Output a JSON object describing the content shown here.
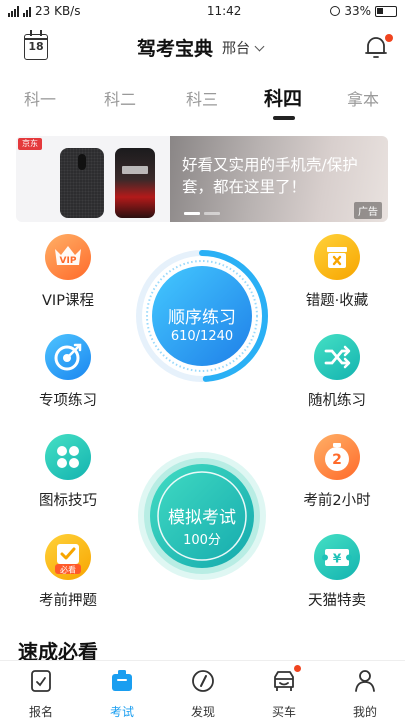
{
  "status_bar": {
    "network": "23 KB/s",
    "time": "11:42",
    "battery": "33%"
  },
  "header": {
    "calendar_day": "18",
    "title": "驾考宝典",
    "city": "邢台"
  },
  "tabs": [
    {
      "label": "科一"
    },
    {
      "label": "科二"
    },
    {
      "label": "科三"
    },
    {
      "label": "科四",
      "active": true
    },
    {
      "label": "拿本"
    }
  ],
  "banner": {
    "store_badge": "京东",
    "text": "好看又实用的手机壳/保护套，都在这里了！",
    "ad_label": "广告"
  },
  "features": {
    "vip": {
      "label": "VIP课程",
      "icon_text": "VIP"
    },
    "wrong": {
      "label": "错题·收藏"
    },
    "topic": {
      "label": "专项练习"
    },
    "random": {
      "label": "随机练习"
    },
    "tips": {
      "label": "图标技巧"
    },
    "last2h": {
      "label": "考前2小时",
      "icon_text": "2"
    },
    "predict": {
      "label": "考前押题",
      "icon_text": "必看"
    },
    "tmall": {
      "label": "天猫特卖",
      "icon_text": "¥"
    }
  },
  "practice": {
    "label": "顺序练习",
    "progress_text": "610/1240",
    "progress": 0.49
  },
  "exam": {
    "label": "模拟考试",
    "score_text": "100分"
  },
  "section": {
    "title": "速成必看"
  },
  "bottom_nav": [
    {
      "label": "报名"
    },
    {
      "label": "考试",
      "active": true
    },
    {
      "label": "发现"
    },
    {
      "label": "买车",
      "badge": true
    },
    {
      "label": "我的"
    }
  ],
  "colors": {
    "accent": "#1a9ef0",
    "orange": "#ff7a2f",
    "teal": "#1fc2b8",
    "badge_red": "#f0441f"
  }
}
